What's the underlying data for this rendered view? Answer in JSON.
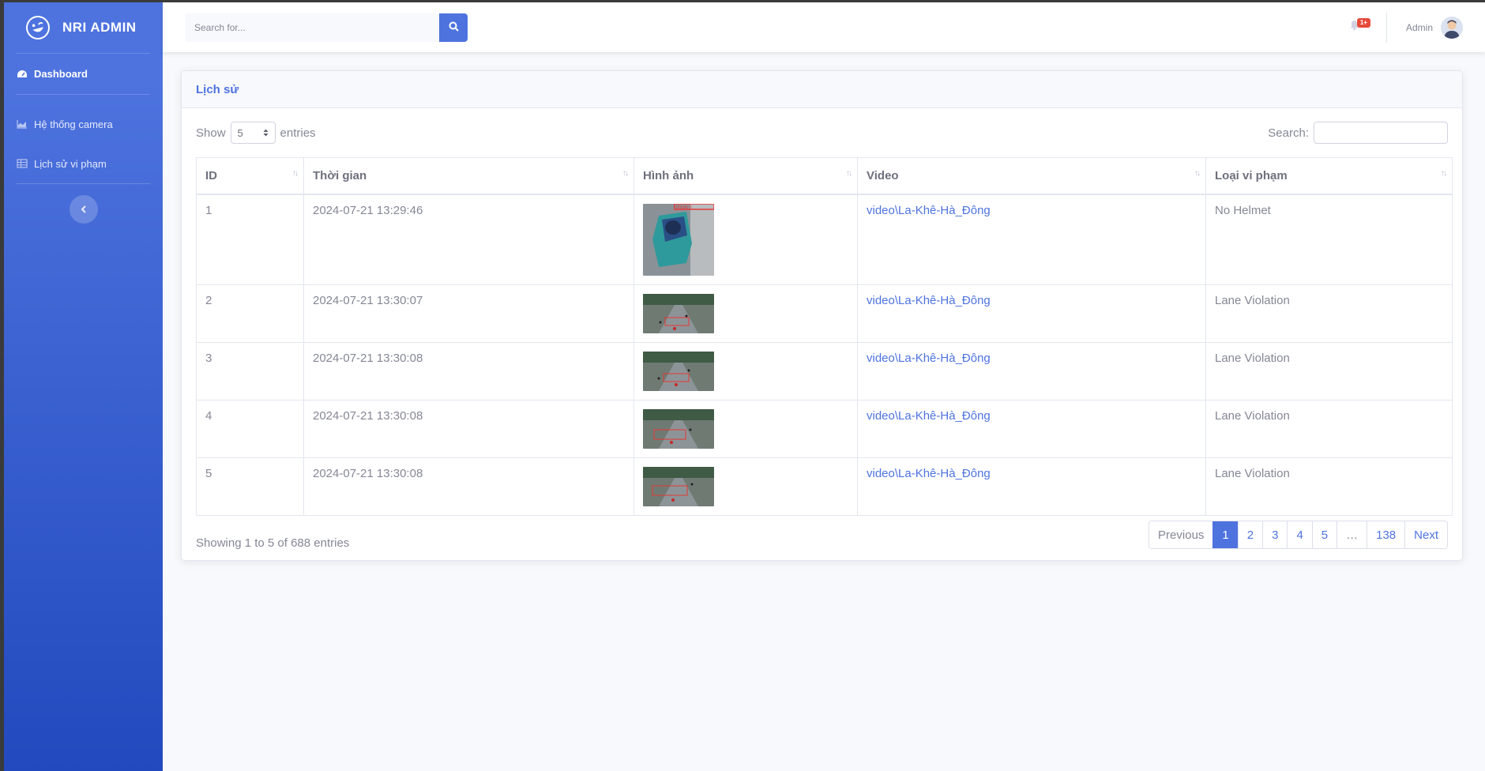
{
  "brand": {
    "name": "NRI ADMIN"
  },
  "sidebar": {
    "items": [
      {
        "label": "Dashboard",
        "icon": "tachometer-icon"
      },
      {
        "label": "Hệ thống camera",
        "icon": "chart-area-icon"
      },
      {
        "label": "Lịch sử vi phạm",
        "icon": "table-icon"
      }
    ],
    "toggle_icon": "chevron-left-icon"
  },
  "topbar": {
    "search_placeholder": "Search for...",
    "alert_badge": "1+",
    "user_name": "Admin"
  },
  "card": {
    "title": "Lịch sử",
    "show_label": "Show",
    "entries_label": "entries",
    "length_value": "5",
    "search_label": "Search:",
    "columns": [
      "ID",
      "Thời gian",
      "Hình ảnh",
      "Video",
      "Loại vi phạm"
    ],
    "rows": [
      {
        "id": "1",
        "time": "2024-07-21 13:29:46",
        "image": "helmet-frame",
        "video": "video\\La-Khê-Hà_Đông",
        "type": "No Helmet"
      },
      {
        "id": "2",
        "time": "2024-07-21 13:30:07",
        "image": "traffic-frame",
        "video": "video\\La-Khê-Hà_Đông",
        "type": "Lane Violation"
      },
      {
        "id": "3",
        "time": "2024-07-21 13:30:08",
        "image": "traffic-frame",
        "video": "video\\La-Khê-Hà_Đông",
        "type": "Lane Violation"
      },
      {
        "id": "4",
        "time": "2024-07-21 13:30:08",
        "image": "traffic-frame",
        "video": "video\\La-Khê-Hà_Đông",
        "type": "Lane Violation"
      },
      {
        "id": "5",
        "time": "2024-07-21 13:30:08",
        "image": "traffic-frame",
        "video": "video\\La-Khê-Hà_Đông",
        "type": "Lane Violation"
      }
    ],
    "info": "Showing 1 to 5 of 688 entries",
    "pagination": {
      "previous": "Previous",
      "pages": [
        "1",
        "2",
        "3",
        "4",
        "5",
        "…",
        "138"
      ],
      "next": "Next",
      "active": "1"
    }
  },
  "colors": {
    "primary": "#4e73df",
    "sidebar_end": "#224abe",
    "text_muted": "#858796",
    "danger": "#e74a3b"
  }
}
